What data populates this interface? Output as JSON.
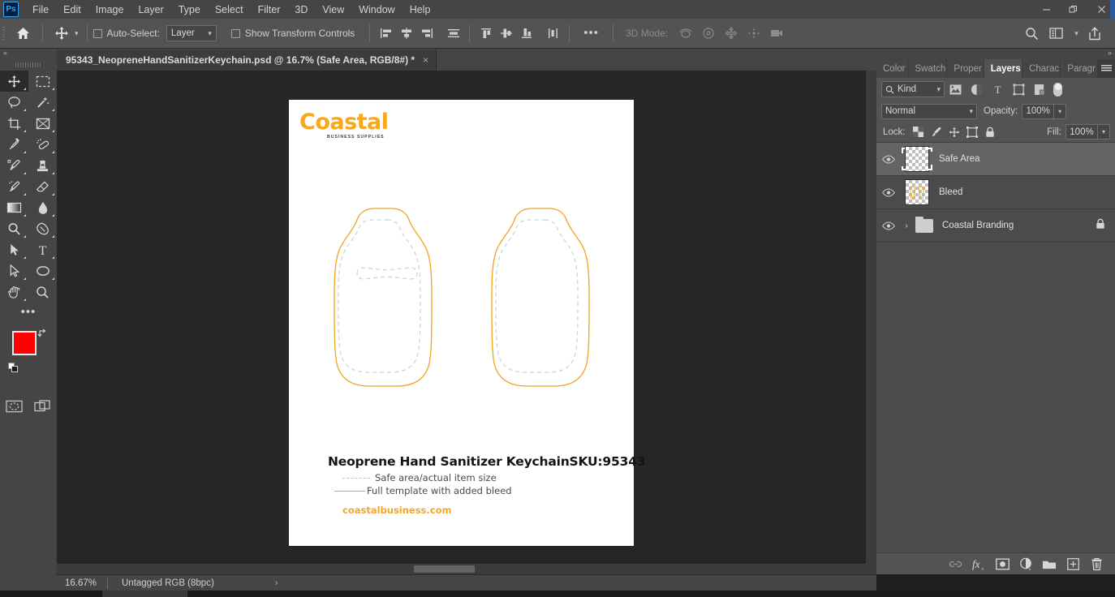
{
  "app": {
    "name": "Ps",
    "menu": [
      "File",
      "Edit",
      "Image",
      "Layer",
      "Type",
      "Select",
      "Filter",
      "3D",
      "View",
      "Window",
      "Help"
    ],
    "window_controls": {
      "minimize": "–",
      "restore": "❐",
      "close": "×"
    }
  },
  "options_bar": {
    "home_icon": "home-icon",
    "tool_icon": "move-tool-icon",
    "auto_select_label": "Auto-Select:",
    "auto_select_checked": false,
    "layer_select_value": "Layer",
    "show_transform_label": "Show Transform Controls",
    "show_transform_checked": false,
    "more_label": "•••",
    "mode_3d_label": "3D Mode:",
    "search_icon": "search-icon",
    "workspace_icon": "workspace-icon",
    "share_icon": "share-icon"
  },
  "toolbox": {
    "collapse_label": "«",
    "tools": [
      {
        "name": "move-tool",
        "selected": true
      },
      {
        "name": "rectangular-marquee-tool",
        "selected": false
      },
      {
        "name": "lasso-tool",
        "selected": false
      },
      {
        "name": "magic-wand-tool",
        "selected": false
      },
      {
        "name": "crop-tool",
        "selected": false
      },
      {
        "name": "frame-tool",
        "selected": false
      },
      {
        "name": "eyedropper-tool",
        "selected": false
      },
      {
        "name": "healing-brush-tool",
        "selected": false
      },
      {
        "name": "brush-tool",
        "selected": false
      },
      {
        "name": "clone-stamp-tool",
        "selected": false
      },
      {
        "name": "history-brush-tool",
        "selected": false
      },
      {
        "name": "eraser-tool",
        "selected": false
      },
      {
        "name": "gradient-tool",
        "selected": false
      },
      {
        "name": "blur-tool",
        "selected": false
      },
      {
        "name": "dodge-tool",
        "selected": false
      },
      {
        "name": "pen-tool",
        "selected": false
      },
      {
        "name": "path-selection-tool",
        "selected": false
      },
      {
        "name": "type-tool",
        "selected": false
      },
      {
        "name": "direct-selection-tool",
        "selected": false
      },
      {
        "name": "ellipse-tool",
        "selected": false
      },
      {
        "name": "hand-tool",
        "selected": false
      },
      {
        "name": "zoom-tool",
        "selected": false
      }
    ],
    "edit_toolbar_label": "•••",
    "foreground_color": "#ff0000",
    "background_color": "#000000",
    "quick_mask_icon": "quick-mask-icon",
    "screen_mode_icon": "screen-mode-icon"
  },
  "document_tab": {
    "title": "95343_NeopreneHandSanitizerKeychain.psd @ 16.7% (Safe Area, RGB/8#) *",
    "close_label": "×"
  },
  "canvas": {
    "logo_word": "Coastal",
    "logo_sub": "BUSINESS SUPPLIES",
    "caption_title": "Neoprene Hand Sanitizer Keychain",
    "caption_sku": "SKU:95343",
    "legend_safe": "Safe area/actual item size",
    "legend_bleed": "Full template with added bleed",
    "url": "coastalbusiness.com",
    "safe_color": "#a8ccc8",
    "bleed_color": "#f2a31c",
    "brand_color": "#f7a81b"
  },
  "status_bar": {
    "zoom": "16.67%",
    "doc_info": "Untagged RGB (8bpc)",
    "arrow": "›"
  },
  "dock": {
    "collapse_label": "»",
    "tabs": [
      {
        "label": "Color",
        "active": false
      },
      {
        "label": "Swatch",
        "active": false
      },
      {
        "label": "Proper",
        "active": false
      },
      {
        "label": "Layers",
        "active": true
      },
      {
        "label": "Charac",
        "active": false
      },
      {
        "label": "Paragr",
        "active": false
      }
    ],
    "menu_icon": "panel-menu-icon"
  },
  "layers_panel": {
    "filter_kind_label": "Kind",
    "filter_icons": [
      "pixel-filter-icon",
      "adjustment-filter-icon",
      "type-filter-icon",
      "shape-filter-icon",
      "smart-object-filter-icon"
    ],
    "filter_toggle": "filter-toggle-switch",
    "blend_mode": "Normal",
    "opacity_label": "Opacity:",
    "opacity_value": "100%",
    "lock_label": "Lock:",
    "lock_icons": [
      "lock-transparent-pixels-icon",
      "lock-image-pixels-icon",
      "lock-position-icon",
      "lock-artboard-nesting-icon",
      "lock-all-icon"
    ],
    "fill_label": "Fill:",
    "fill_value": "100%",
    "layers": [
      {
        "name": "Safe Area",
        "visible": true,
        "selected": true,
        "type": "layer",
        "locked": false
      },
      {
        "name": "Bleed",
        "visible": true,
        "selected": false,
        "type": "layer",
        "locked": false
      },
      {
        "name": "Coastal Branding",
        "visible": true,
        "selected": false,
        "type": "group",
        "locked": true
      }
    ],
    "footer_buttons": [
      {
        "name": "link-layers-button",
        "glyph": "⚭"
      },
      {
        "name": "layer-styles-button",
        "glyph": "fx"
      },
      {
        "name": "layer-mask-button",
        "glyph": "mask"
      },
      {
        "name": "adjustment-layer-button",
        "glyph": "adj"
      },
      {
        "name": "new-group-button",
        "glyph": "folder"
      },
      {
        "name": "new-layer-button",
        "glyph": "+"
      },
      {
        "name": "delete-layer-button",
        "glyph": "trash"
      }
    ]
  }
}
